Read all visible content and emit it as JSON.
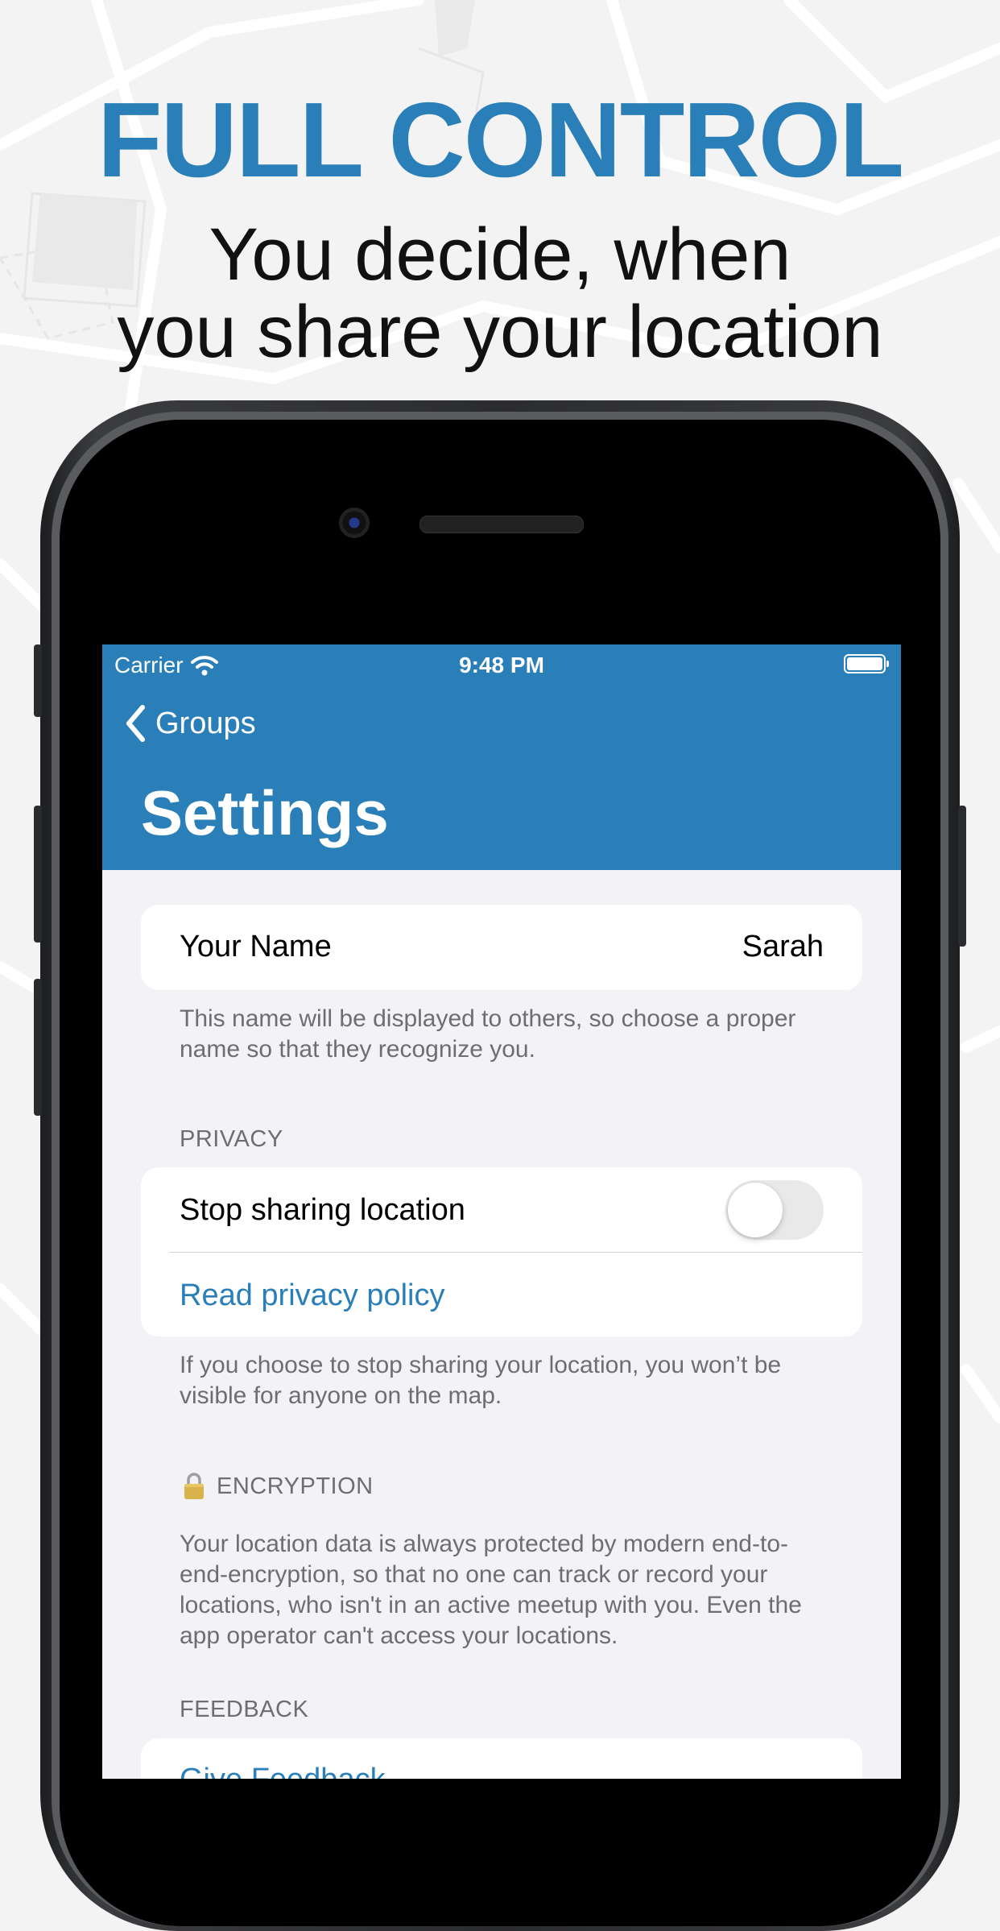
{
  "promo": {
    "headline": "FULL CONTROL",
    "subline_1": "You decide, when",
    "subline_2": "you share your location"
  },
  "status_bar": {
    "carrier": "Carrier",
    "time": "9:48 PM"
  },
  "nav": {
    "back_label": "Groups",
    "title": "Settings"
  },
  "name_section": {
    "label": "Your Name",
    "value": "Sarah",
    "footer": "This name will be displayed to others, so choose a proper name so that they recognize you."
  },
  "privacy_section": {
    "header": "PRIVACY",
    "stop_sharing_label": "Stop sharing location",
    "stop_sharing_on": false,
    "policy_link": "Read privacy policy",
    "footer": "If you choose to stop sharing your location, you won’t be visible for anyone on the map."
  },
  "encryption_section": {
    "icon": "lock-icon",
    "header": "ENCRYPTION",
    "footer": "Your location data is always protected by modern end-to-end-encryption, so that no one can track or record your locations, who isn't in an active meetup with you. Even the app operator can't access your locations."
  },
  "feedback_section": {
    "header": "FEEDBACK",
    "give_feedback_label": "Give Feedback"
  },
  "colors": {
    "accent": "#2a7fb8",
    "background": "#f2f2f7"
  }
}
